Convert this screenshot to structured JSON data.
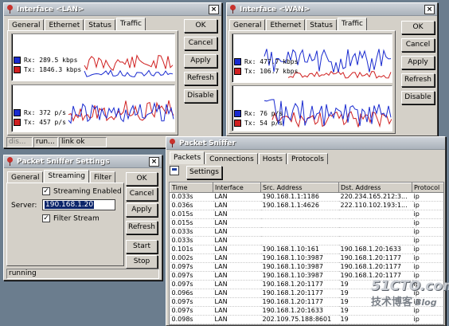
{
  "lan_window": {
    "title": "Interface <LAN>",
    "tabs": [
      "General",
      "Ethernet",
      "Status",
      "Traffic"
    ],
    "buttons": [
      "OK",
      "Cancel",
      "Apply",
      "Refresh",
      "Disable"
    ],
    "rx_rate": "Rx: 289.5 kbps",
    "tx_rate": "Tx: 1846.3 kbps",
    "rx_packets": "Rx: 372 p/s",
    "tx_packets": "Tx: 457 p/s",
    "status": [
      "dis...",
      "run...",
      "link ok"
    ]
  },
  "wan_window": {
    "title": "Interface <WAN>",
    "tabs": [
      "General",
      "Ethernet",
      "Status",
      "Traffic"
    ],
    "buttons": [
      "OK",
      "Cancel",
      "Apply",
      "Refresh",
      "Disable"
    ],
    "rx_rate": "Rx: 477.7 kbps",
    "tx_rate": "Tx: 106.7 kbps",
    "rx_packets": "Rx: 76 p/s",
    "tx_packets": "Tx: 54 p/s"
  },
  "sniffer_settings": {
    "title": "Packet Sniffer Settings",
    "tabs": [
      "General",
      "Streaming",
      "Filter"
    ],
    "streaming_enabled_label": "Streaming Enabled",
    "server_label": "Server:",
    "server_value": "190.168.1.20",
    "filter_stream_label": "Filter Stream",
    "buttons": [
      "OK",
      "Cancel",
      "Apply",
      "Refresh",
      "Start",
      "Stop"
    ],
    "status": "running"
  },
  "sniffer": {
    "title": "Packet Sniffer",
    "tabs": [
      "Packets",
      "Connections",
      "Hosts",
      "Protocols"
    ],
    "settings_button": "Settings",
    "columns": [
      "Time",
      "Interface",
      "Src. Address",
      "Dst. Address",
      "Protocol"
    ],
    "rows": [
      [
        "0.033s",
        "LAN",
        "190.168.1.1:1186",
        "220.234.165.212:3...",
        "ip"
      ],
      [
        "0.036s",
        "LAN",
        "190.168.1.1:4626",
        "222.110.102.193:1...",
        "ip"
      ],
      [
        "0.015s",
        "LAN",
        "",
        "",
        "ip"
      ],
      [
        "0.015s",
        "LAN",
        "",
        "",
        "ip"
      ],
      [
        "0.033s",
        "LAN",
        "",
        "",
        "ip"
      ],
      [
        "0.033s",
        "LAN",
        "",
        "",
        "ip"
      ],
      [
        "0.101s",
        "LAN",
        "190.168.1.10:161",
        "190.168.1.20:1633",
        "ip"
      ],
      [
        "0.002s",
        "LAN",
        "190.168.1.10:3987",
        "190.168.1.20:1177",
        "ip"
      ],
      [
        "0.097s",
        "LAN",
        "190.168.1.10:3987",
        "190.168.1.20:1177",
        "ip"
      ],
      [
        "0.097s",
        "LAN",
        "190.168.1.10:3987",
        "190.168.1.20:1177",
        "ip"
      ],
      [
        "0.097s",
        "LAN",
        "190.168.1.20:1177",
        "19",
        "ip"
      ],
      [
        "0.096s",
        "LAN",
        "190.168.1.20:1177",
        "19",
        "ip"
      ],
      [
        "0.097s",
        "LAN",
        "190.168.1.20:1177",
        "19",
        "ip"
      ],
      [
        "0.097s",
        "LAN",
        "190.168.1.20:1633",
        "19",
        "ip"
      ],
      [
        "0.098s",
        "LAN",
        "202.109.75.188:8601",
        "19",
        "ip"
      ]
    ]
  },
  "watermark": {
    "site": "51CTO.com",
    "sub": "技术博客",
    "blog": "Blog"
  },
  "colors": {
    "rx": "#1a2bd0",
    "tx": "#d02020",
    "titlebar": "#aab2bb"
  }
}
